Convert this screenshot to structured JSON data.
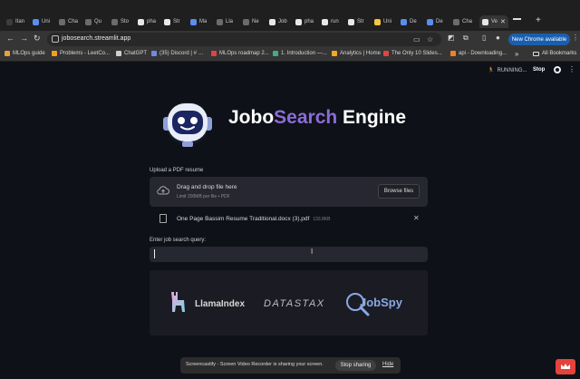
{
  "browser": {
    "tabs": [
      {
        "label": "Itan",
        "color": "#3c3c3c"
      },
      {
        "label": "Uni",
        "color": "#5b8def"
      },
      {
        "label": "Cha",
        "color": "#6c6c6c"
      },
      {
        "label": "Qu",
        "color": "#6c6c6c"
      },
      {
        "label": "Sto",
        "color": "#6c6c6c"
      },
      {
        "label": "pha",
        "color": "#e8e8e8"
      },
      {
        "label": "Str",
        "color": "#e8e8e8"
      },
      {
        "label": "Ma",
        "color": "#5b8def"
      },
      {
        "label": "Lla",
        "color": "#6c6c6c"
      },
      {
        "label": "Ne",
        "color": "#6c6c6c"
      },
      {
        "label": "Job",
        "color": "#e8e8e8"
      },
      {
        "label": "pha",
        "color": "#e8e8e8"
      },
      {
        "label": "run",
        "color": "#e8e8e8"
      },
      {
        "label": "Str",
        "color": "#e8e8e8"
      },
      {
        "label": "Uni",
        "color": "#f4c542"
      },
      {
        "label": "De",
        "color": "#5b8def"
      },
      {
        "label": "De",
        "color": "#5b8def"
      },
      {
        "label": "Cha",
        "color": "#6c6c6c"
      },
      {
        "label": "Ve",
        "color": "#e8e8e8"
      }
    ],
    "url": "jobosearch.streamlit.app",
    "update_chip": "New Chrome available",
    "bookmarks": [
      {
        "label": "MLOps guide",
        "color": "#e8a13c"
      },
      {
        "label": "Problems - LeetCo...",
        "color": "#f0a020"
      },
      {
        "label": "ChatGPT",
        "color": "#cfcfcf"
      },
      {
        "label": "(35) Discord | # …",
        "color": "#7289da"
      },
      {
        "label": "MLOps roadmap 2...",
        "color": "#d44"
      },
      {
        "label": "1. Introduction —...",
        "color": "#4a8"
      },
      {
        "label": "Analytics | Home",
        "color": "#f4a623"
      },
      {
        "label": "The Only 10 Slides...",
        "color": "#d44"
      },
      {
        "label": "api - Downloading...",
        "color": "#f48024"
      }
    ],
    "all_bookmarks": "All Bookmarks"
  },
  "app": {
    "status": "RUNNING...",
    "stop": "Stop",
    "title": {
      "part1": "Jobo",
      "part2": "Search",
      "part3": " Engine"
    },
    "upload": {
      "label": "Upload a PDF resume",
      "drag_text": "Drag and drop file here",
      "limit_text": "Limit 200MB per file • PDF",
      "browse": "Browse files",
      "file_name": "One Page Bassim Resume Traditional.docx (3).pdf",
      "file_size": "133.8KB"
    },
    "query": {
      "label": "Enter job search query:",
      "value": ""
    },
    "sponsors": {
      "llama": "LlamaIndex",
      "datastax": "DATASTAX",
      "jobspy": "JobSpy"
    }
  },
  "share_bar": {
    "message": "Screencastify - Screen Video Recorder is sharing your screen.",
    "stop": "Stop sharing",
    "hide": "Hide"
  },
  "colors": {
    "background": "#0e1117",
    "accent_purple": "#8b6cd6",
    "input_bg": "#262730",
    "chrome_blue": "#1a5fae",
    "ext_red": "#e2443d"
  }
}
